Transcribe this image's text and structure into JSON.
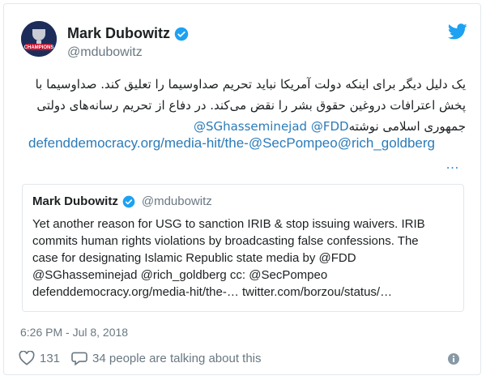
{
  "author": {
    "name": "Mark Dubowitz",
    "handle": "@mdubowitz",
    "avatar_text": "CHAMPIONS"
  },
  "tweet": {
    "text_line1": "یک دلیل دیگر برای اینکه دولت آمریکا نباید تحریم صداوسیما را تعلیق کند. صداوسیما با",
    "text_line2": "پخش اعترافات دروغین حقوق بشر را نقض می‌کند. در دفاع از تحریم رسانه‌های دولتی",
    "text_line3": "جمهوری اسلامی نوشته",
    "mention_fdd": "@FDD",
    "mention_sg": "@SGhasseminejad",
    "link": "defenddemocracy.org/media-hit/the-@SecPompeo@rich_goldberg",
    "ellipsis": "…"
  },
  "quote": {
    "name": "Mark Dubowitz",
    "handle": "@mdubowitz",
    "lines": [
      "Yet another reason for USG to sanction IRIB & stop issuing waivers. IRIB",
      "commits human rights violations by broadcasting false confessions. The",
      "case for designating Islamic Republic state media by @FDD",
      "@SGhasseminejad @rich_goldberg cc: @SecPompeo",
      "defenddemocracy.org/media-hit/the-… twitter.com/borzou/status/…"
    ]
  },
  "meta": {
    "timestamp": "6:26 PM - Jul 8, 2018",
    "likes": "131",
    "talking": "34 people are talking about this"
  },
  "colors": {
    "link": "#2b7bb9",
    "verified": "#1da1f2",
    "muted": "#697882",
    "border": "#e1e8ed"
  },
  "icons": [
    "twitter-bird-icon",
    "verified-icon",
    "heart-icon",
    "comment-icon",
    "info-icon"
  ]
}
